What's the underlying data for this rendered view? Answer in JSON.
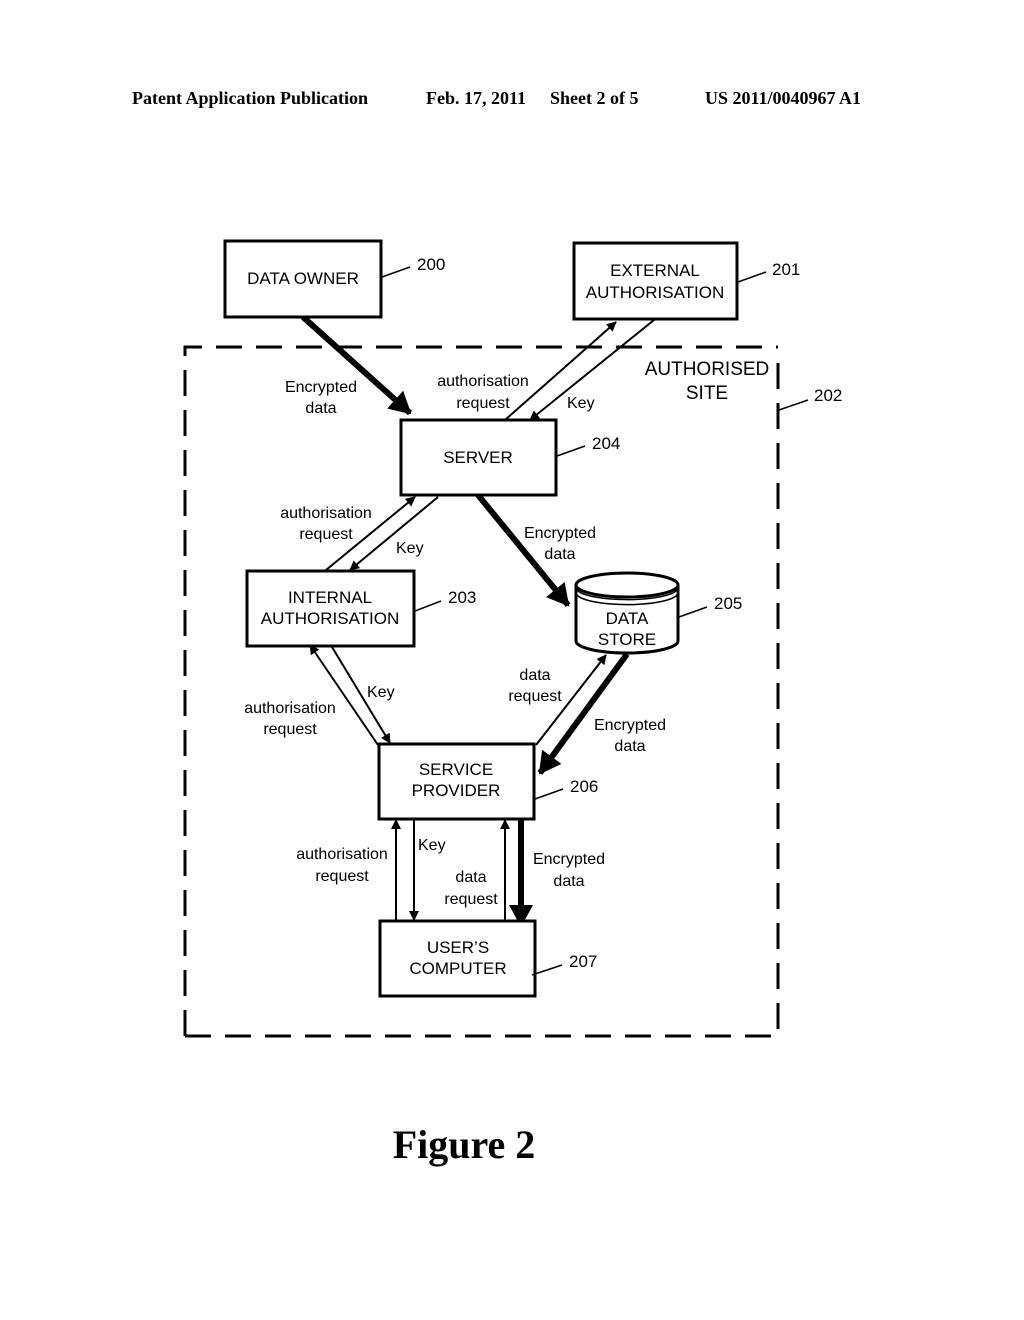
{
  "header": {
    "publication": "Patent Application Publication",
    "date": "Feb. 17, 2011",
    "sheet": "Sheet 2 of 5",
    "number": "US 2011/0040967 A1"
  },
  "figure_label": "Figure 2",
  "site": {
    "label_line1": "AUTHORISED",
    "label_line2": "SITE",
    "ref": "202"
  },
  "nodes": {
    "data_owner": {
      "line1": "DATA OWNER",
      "ref": "200"
    },
    "external_auth": {
      "line1": "EXTERNAL",
      "line2": "AUTHORISATION",
      "ref": "201"
    },
    "internal_auth": {
      "line1": "INTERNAL",
      "line2": "AUTHORISATION",
      "ref": "203"
    },
    "server": {
      "line1": "SERVER",
      "ref": "204"
    },
    "data_store": {
      "line1": "DATA",
      "line2": "STORE",
      "ref": "205"
    },
    "service_provider": {
      "line1": "SERVICE",
      "line2": "PROVIDER",
      "ref": "206"
    },
    "users_computer": {
      "line1": "USER’S",
      "line2": "COMPUTER",
      "ref": "207"
    }
  },
  "edges": {
    "owner_server": {
      "line1": "Encrypted",
      "line2": "data"
    },
    "server_ext_req": {
      "line1": "authorisation",
      "line2": "request"
    },
    "ext_server_key": {
      "line1": "Key"
    },
    "server_int_req": {
      "line1": "authorisation",
      "line2": "request"
    },
    "int_server_key": {
      "line1": "Key"
    },
    "server_store": {
      "line1": "Encrypted",
      "line2": "data"
    },
    "sp_int_req": {
      "line1": "authorisation",
      "line2": "request"
    },
    "int_sp_key": {
      "line1": "Key"
    },
    "sp_store_req": {
      "line1": "data",
      "line2": "request"
    },
    "store_sp_data": {
      "line1": "Encrypted",
      "line2": "data"
    },
    "uc_sp_req": {
      "line1": "authorisation",
      "line2": "request"
    },
    "sp_uc_key": {
      "line1": "Key"
    },
    "uc_sp_datareq": {
      "line1": "data",
      "line2": "request"
    },
    "sp_uc_data": {
      "line1": "Encrypted",
      "line2": "data"
    }
  }
}
